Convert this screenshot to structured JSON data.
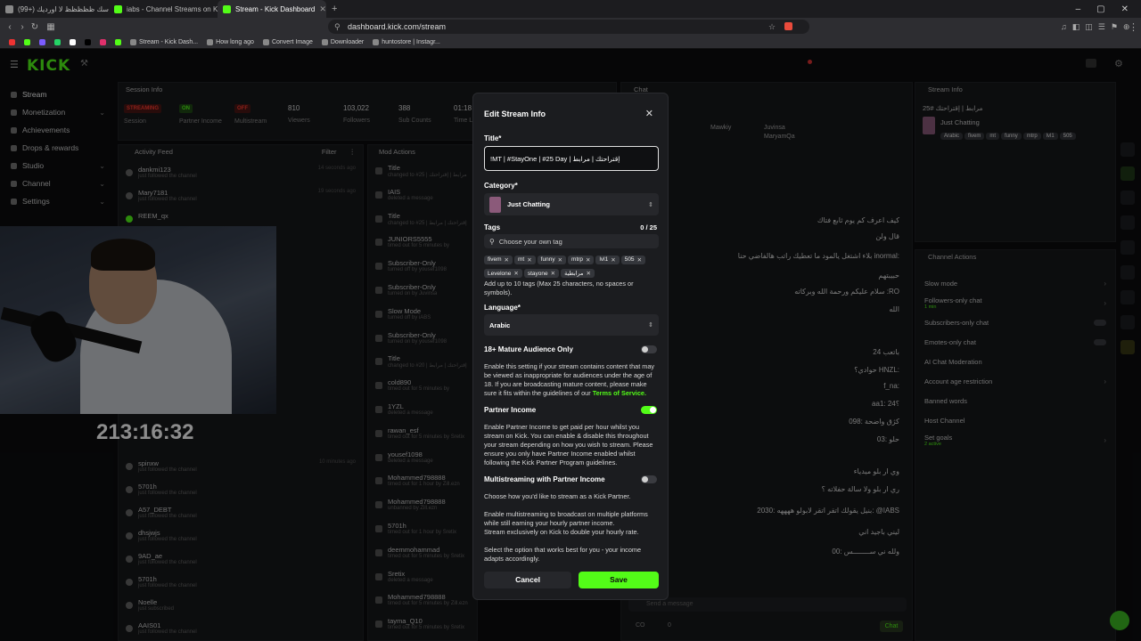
{
  "browser": {
    "tabs": [
      {
        "label": "(99+) لاسك ظظظظظ لا اورديك Fiabs@",
        "active": false
      },
      {
        "label": "iabs - Channel Streams on Kick: View",
        "active": false
      },
      {
        "label": "Stream - Kick Dashboard",
        "active": true
      }
    ],
    "url": "dashboard.kick.com/stream",
    "bookmarks": [
      "Stream - Kick Dash...",
      "How long ago",
      "Convert Image",
      "Downloader",
      "huntostore | Instagr..."
    ]
  },
  "brand": {
    "logo": "KICK",
    "accent": "#53fc18"
  },
  "nav": {
    "items": [
      {
        "label": "Stream",
        "active": true,
        "chevron": false
      },
      {
        "label": "Monetization",
        "active": false,
        "chevron": true
      },
      {
        "label": "Achievements",
        "active": false,
        "chevron": false
      },
      {
        "label": "Drops & rewards",
        "active": false,
        "chevron": false
      },
      {
        "label": "Studio",
        "active": false,
        "chevron": true
      },
      {
        "label": "Channel",
        "active": false,
        "chevron": true
      },
      {
        "label": "Settings",
        "active": false,
        "chevron": true
      }
    ]
  },
  "session": {
    "header": "Session Info",
    "badges": [
      {
        "text": "STREAMING",
        "caption": "Session"
      },
      {
        "text": "ON",
        "caption": "Partner Income"
      },
      {
        "text": "OFF",
        "caption": "Multistream"
      }
    ],
    "stats": [
      {
        "value": "810",
        "label": "Viewers"
      },
      {
        "value": "103,022",
        "label": "Followers"
      },
      {
        "value": "388",
        "label": "Sub Counts"
      },
      {
        "value": "01:18",
        "label": "Time L"
      }
    ]
  },
  "activity": {
    "header": "Activity Feed",
    "filter_label": "Filter",
    "rows": [
      {
        "name": "dankmi123",
        "sub": "just followed the channel",
        "time": "14 seconds ago"
      },
      {
        "name": "Mary7181",
        "sub": "just followed the channel",
        "time": "19 seconds ago"
      },
      {
        "name": "REEM_qx",
        "sub": "",
        "time": ""
      },
      {
        "name": "spinxw",
        "sub": "just followed the channel",
        "time": "10 minutes ago"
      },
      {
        "name": "5701h",
        "sub": "just followed the channel",
        "time": ""
      },
      {
        "name": "A57_DEBT",
        "sub": "just followed the channel",
        "time": ""
      },
      {
        "name": "dhsjwjs",
        "sub": "just followed the channel",
        "time": ""
      },
      {
        "name": "9AD_ae",
        "sub": "just followed the channel",
        "time": ""
      },
      {
        "name": "5701h",
        "sub": "just followed the channel",
        "time": ""
      },
      {
        "name": "Noelle",
        "sub": "just subscribed",
        "time": ""
      },
      {
        "name": "AAIS01",
        "sub": "just followed the channel",
        "time": ""
      }
    ]
  },
  "mod": {
    "header": "Mod Actions",
    "rows": [
      {
        "name": "Title",
        "sub": "changed to #25 | مرابط | إقتراحتك"
      },
      {
        "name": "IAIS",
        "sub": "deleted a message"
      },
      {
        "name": "Title",
        "sub": "changed to #25 | إقتراحتك | مرابط"
      },
      {
        "name": "JUNIORS5555",
        "sub": "timed out for 5 minutes by"
      },
      {
        "name": "Subscriber-Only",
        "sub": "turned off by yousef1098"
      },
      {
        "name": "Subscriber-Only",
        "sub": "turned on by Juvinsa"
      },
      {
        "name": "Slow Mode",
        "sub": "turned off by iABS"
      },
      {
        "name": "Subscriber-Only",
        "sub": "turned on by yousef1098"
      },
      {
        "name": "Title",
        "sub": "changed to #20 | إقتراحتك | مرابط"
      },
      {
        "name": "cold890",
        "sub": "timed out for 5 minutes by"
      },
      {
        "name": "1YZL",
        "sub": "deleted a message"
      },
      {
        "name": "rawan_esf",
        "sub": "timed out for 5 minutes by Sretix"
      },
      {
        "name": "yousef1098",
        "sub": "deleted a message"
      },
      {
        "name": "Mohammed798888",
        "sub": "timed out for 1 hour by Zill.ezn"
      },
      {
        "name": "Mohammed798888",
        "sub": "unbanned by Zill.ezn"
      },
      {
        "name": "5701h",
        "sub": "timed out for 1 hour by Sretix"
      },
      {
        "name": "deemmohammad",
        "sub": "timed out for 5 minutes by Sretix"
      },
      {
        "name": "Sretix",
        "sub": "deleted a message"
      },
      {
        "name": "Mohammed798888",
        "sub": "timed out for 5 minutes by Zill.ezn"
      },
      {
        "name": "tayma_Q10",
        "sub": "timed out for 5 minutes by Sretix"
      }
    ]
  },
  "timer": "213:16:32",
  "chat": {
    "header": "Chat",
    "top_users": [
      "Mawkiy",
      "Juvinsa",
      "MaryamQa"
    ],
    "lines": [
      "كيف اعرف كم يوم ثابع فتاك",
      "قال ولن",
      "بلاء اشتغل يالمود ما تعطيك راتب هالفاضي حنا inormal:",
      "حبيبتهم",
      "سلام عليكم ورحمة الله وبركاته :RO",
      "الله",
      "باتعب 24",
      "حوادي؟ HNZL:",
      "f_na:",
      "aa1: 24؟",
      "كژق واضحة :098",
      "حلو :03",
      "وي ار بلو ميدياء",
      "ري ار بلو ولا سالة حفلاته ؟",
      "بنيل يقولك اتقر اتقر لابولو ههههه :2030: @IABS",
      "ليني باجيد اني",
      "ولله ني ســــــــس :00"
    ],
    "input_placeholder": "Send a message",
    "send_label": "Chat",
    "counts": [
      "CO",
      "0"
    ]
  },
  "stream_info": {
    "header": "Stream Info",
    "title": "مرابط | إقتراحتك #25",
    "category": "Just Chatting",
    "tags": [
      "Arabic",
      "fivem",
      "mt",
      "funny",
      "mtrp",
      "lvl1",
      "505"
    ]
  },
  "channel_actions": {
    "header": "Channel Actions",
    "rows": [
      {
        "label": "Slow mode",
        "control": "chevron"
      },
      {
        "label": "Followers-only chat",
        "control": "chevron",
        "note": "1 min"
      },
      {
        "label": "Subscribers-only chat",
        "control": "toggle"
      },
      {
        "label": "Emotes-only chat",
        "control": "toggle"
      },
      {
        "label": "AI Chat Moderation",
        "control": "none"
      },
      {
        "label": "Account age restriction",
        "control": "chevron"
      },
      {
        "label": "Banned words",
        "control": "none"
      },
      {
        "label": "Host Channel",
        "control": "none"
      },
      {
        "label": "Set goals",
        "control": "chevron",
        "note": "2 active"
      }
    ]
  },
  "modal": {
    "title": "Edit Stream Info",
    "title_label": "Title*",
    "title_value": "!MT | #StayOne | #25 Day | إقتراحتك | مرابط",
    "category_label": "Category*",
    "category_value": "Just Chatting",
    "tags_label": "Tags",
    "tags_count": "0 / 25",
    "tags_placeholder": "Choose your own tag",
    "tags": [
      "fivem",
      "mt",
      "funny",
      "mtrp",
      "lvl1",
      "505",
      "Levelone",
      "stayone",
      "مرابطية"
    ],
    "tags_help": "Add up to 10 tags (Max 25 characters, no spaces or symbols).",
    "language_label": "Language*",
    "language_value": "Arabic",
    "mature_label": "18+ Mature Audience Only",
    "mature_on": false,
    "mature_help": "Enable this setting if your stream contains content that may be viewed as inappropriate for audiences under the age of 18. If you are broadcasting mature content, please make sure it fits within the guidelines of our",
    "mature_link": "Terms of Service.",
    "partner_label": "Partner Income",
    "partner_on": true,
    "partner_help": "Enable Partner Income to get paid per hour whilst you stream on Kick. You can enable & disable this throughout your stream depending on how you wish to stream. Please ensure you only have Partner Income enabled whilst following the Kick Partner Program guidelines.",
    "multistream_label": "Multistreaming with Partner Income",
    "multistream_on": false,
    "multistream_help1": "Choose how you'd like to stream as a Kick Partner.",
    "multistream_help2": "Enable multistreaming to broadcast on multiple platforms while still earning your hourly partner income.",
    "multistream_help3": "Stream exclusively on Kick to double your hourly rate.",
    "multistream_help4": "Select the option that works best for you - your income adapts accordingly.",
    "cancel_label": "Cancel",
    "save_label": "Save"
  }
}
